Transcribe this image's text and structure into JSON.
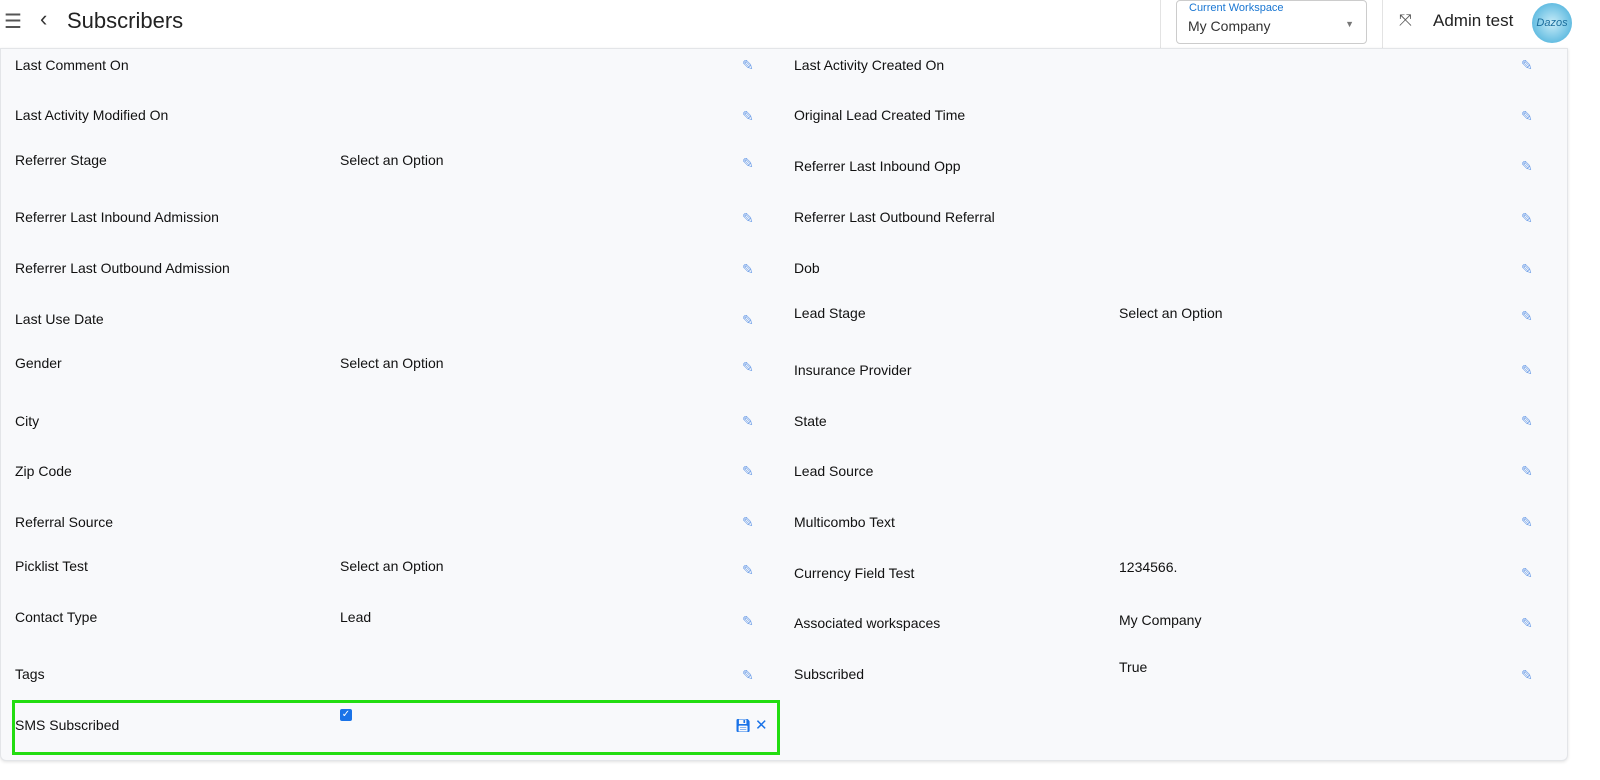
{
  "header": {
    "title": "Subscribers",
    "workspace_label": "Current Workspace",
    "workspace_value": "My Company",
    "user_name": "Admin test",
    "avatar_text": "Dazos",
    "icons": {
      "menu": "hamburger-icon",
      "back": "chevron-left-icon",
      "expand": "expand-icon"
    }
  },
  "left_fields": [
    {
      "label": "Last Comment On",
      "value": ""
    },
    {
      "label": "Last Activity Modified On",
      "value": ""
    },
    {
      "label": "Referrer Stage",
      "value": "Select an Option"
    },
    {
      "label": "Referrer Last Inbound Admission",
      "value": ""
    },
    {
      "label": "Referrer Last Outbound Admission",
      "value": ""
    },
    {
      "label": "Last Use Date",
      "value": ""
    },
    {
      "label": "Gender",
      "value": "Select an Option"
    },
    {
      "label": "City",
      "value": ""
    },
    {
      "label": "Zip Code",
      "value": ""
    },
    {
      "label": "Referral Source",
      "value": ""
    },
    {
      "label": "Picklist Test",
      "value": "Select an Option"
    },
    {
      "label": "Contact Type",
      "value": "Lead"
    },
    {
      "label": "Tags",
      "value": ""
    }
  ],
  "right_fields": [
    {
      "label": "Last Activity Created On",
      "value": ""
    },
    {
      "label": "Original Lead Created Time",
      "value": ""
    },
    {
      "label": "Referrer Last Inbound Opp",
      "value": ""
    },
    {
      "label": "Referrer Last Outbound Referral",
      "value": ""
    },
    {
      "label": "Dob",
      "value": ""
    },
    {
      "label": "Lead Stage",
      "value": "Select an Option"
    },
    {
      "label": "Insurance Provider",
      "value": ""
    },
    {
      "label": "State",
      "value": ""
    },
    {
      "label": "Lead Source",
      "value": ""
    },
    {
      "label": "Multicombo Text",
      "value": ""
    },
    {
      "label": "Currency Field Test",
      "value": "1234566."
    },
    {
      "label": "Associated workspaces",
      "value": "My Company"
    },
    {
      "label": "Subscribed",
      "value": "True"
    }
  ],
  "editing_field": {
    "label": "SMS Subscribed",
    "checked": true,
    "highlight_color": "#22dd11"
  },
  "colors": {
    "accent": "#1a73e8",
    "pencil": "#6d9ee8"
  }
}
